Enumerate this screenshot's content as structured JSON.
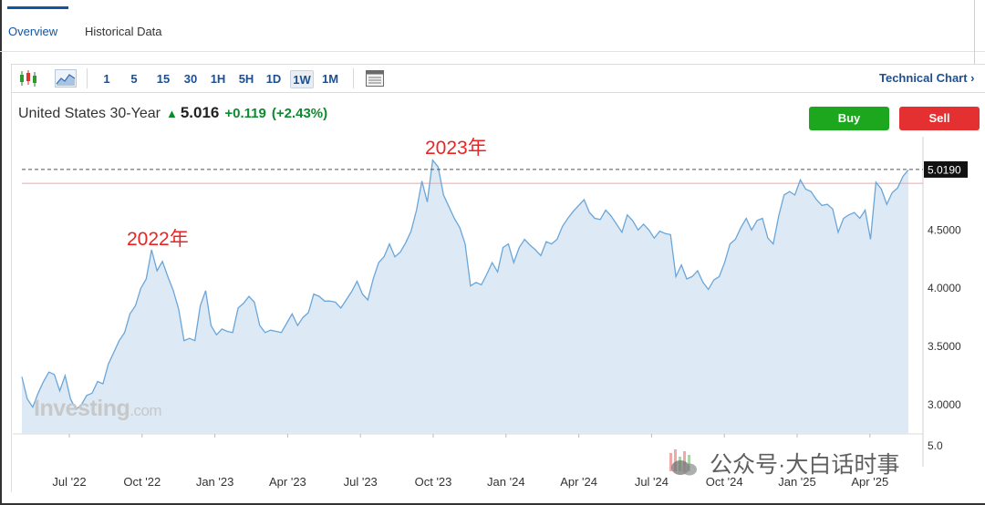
{
  "tabs": [
    {
      "label": "Overview",
      "active": true
    },
    {
      "label": "Historical Data",
      "active": false
    }
  ],
  "toolbar": {
    "icons": [
      "candlestick-icon",
      "area-chart-icon",
      "table-icon"
    ],
    "intervals": [
      "1",
      "5",
      "15",
      "30",
      "1H",
      "5H",
      "1D",
      "1W",
      "1M"
    ],
    "selected_interval": "1W",
    "technical_chart_label": "Technical Chart ›"
  },
  "instrument": {
    "name": "United States 30-Year",
    "price": "5.016",
    "change": "+0.119",
    "change_pct": "(+2.43%)",
    "direction": "up"
  },
  "actions": {
    "buy_label": "Buy",
    "sell_label": "Sell"
  },
  "watermark": {
    "brand": "Investing",
    "suffix": ".com"
  },
  "annotations": [
    {
      "text": "2022年"
    },
    {
      "text": "2023年"
    }
  ],
  "wechat_watermark": "公众号·大白话时事",
  "colors": {
    "line": "#6aa6d9",
    "area": "#dde9f5",
    "up": "#0e8a2e",
    "buy": "#1da71f",
    "sell": "#e43030",
    "annotation": "#ee2222",
    "link": "#1d4f91"
  },
  "chart_data": {
    "type": "area",
    "title": "United States 30-Year",
    "ylim": [
      2.75,
      5.3
    ],
    "y_ticks": [
      3.0,
      3.5,
      4.0,
      4.5
    ],
    "y_tick_labels": [
      "3.0000",
      "3.5000",
      "4.0000",
      "4.5000"
    ],
    "y_bottom_label": "5.0",
    "current_value": 5.019,
    "current_value_label": "5.0190",
    "reference_line": 4.9,
    "x_tick_labels": [
      "Jul '22",
      "Oct '22",
      "Jan '23",
      "Apr '23",
      "Jul '23",
      "Oct '23",
      "Jan '24",
      "Apr '24",
      "Jul '24",
      "Oct '24",
      "Jan '25",
      "Apr '25"
    ],
    "grid": false,
    "series": [
      {
        "values": [
          3.24,
          3.05,
          2.98,
          3.1,
          3.2,
          3.28,
          3.26,
          3.12,
          3.25,
          3.05,
          2.96,
          3.0,
          3.08,
          3.1,
          3.2,
          3.18,
          3.35,
          3.45,
          3.55,
          3.62,
          3.78,
          3.85,
          4.0,
          4.08,
          4.33,
          4.15,
          4.23,
          4.1,
          3.98,
          3.82,
          3.55,
          3.57,
          3.55,
          3.85,
          3.98,
          3.68,
          3.6,
          3.65,
          3.63,
          3.62,
          3.83,
          3.87,
          3.93,
          3.88,
          3.68,
          3.62,
          3.64,
          3.63,
          3.62,
          3.7,
          3.78,
          3.68,
          3.75,
          3.79,
          3.95,
          3.93,
          3.89,
          3.89,
          3.88,
          3.83,
          3.9,
          3.97,
          4.06,
          3.95,
          3.9,
          4.08,
          4.22,
          4.27,
          4.38,
          4.27,
          4.31,
          4.39,
          4.49,
          4.67,
          4.92,
          4.74,
          5.1,
          5.04,
          4.8,
          4.7,
          4.6,
          4.52,
          4.38,
          4.02,
          4.05,
          4.03,
          4.12,
          4.22,
          4.14,
          4.35,
          4.38,
          4.22,
          4.35,
          4.42,
          4.37,
          4.33,
          4.28,
          4.4,
          4.38,
          4.42,
          4.53,
          4.6,
          4.66,
          4.71,
          4.76,
          4.65,
          4.6,
          4.59,
          4.67,
          4.62,
          4.55,
          4.48,
          4.63,
          4.58,
          4.5,
          4.55,
          4.5,
          4.43,
          4.49,
          4.47,
          4.46,
          4.1,
          4.2,
          4.08,
          4.1,
          4.15,
          4.05,
          3.99,
          4.07,
          4.1,
          4.22,
          4.38,
          4.42,
          4.52,
          4.6,
          4.5,
          4.58,
          4.6,
          4.43,
          4.38,
          4.62,
          4.8,
          4.83,
          4.8,
          4.93,
          4.85,
          4.83,
          4.76,
          4.71,
          4.72,
          4.68,
          4.48,
          4.6,
          4.63,
          4.65,
          4.6,
          4.67,
          4.42,
          4.91,
          4.85,
          4.72,
          4.82,
          4.86,
          4.96,
          5.016
        ]
      }
    ]
  }
}
